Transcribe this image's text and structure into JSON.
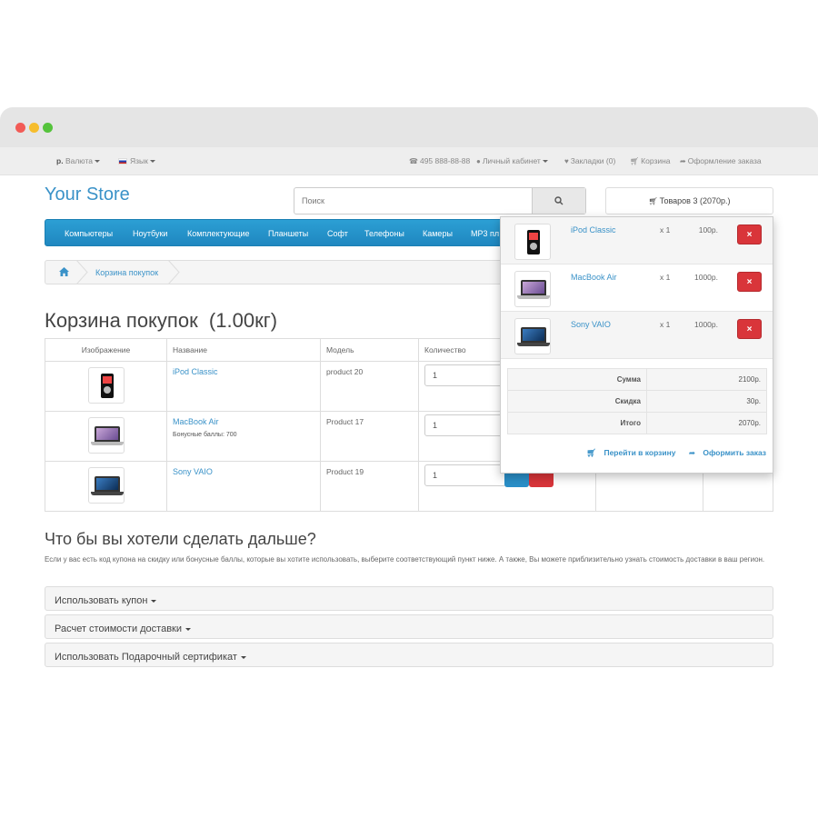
{
  "topbar": {
    "currency": "р.",
    "currency_label": "Валюта",
    "language_label": "Язык",
    "phone": "495 888-88-88",
    "account": "Личный кабинет",
    "wishlist": "Закладки (0)",
    "cart": "Корзина",
    "checkout": "Оформление заказа"
  },
  "header": {
    "logo": "Your Store",
    "search_placeholder": "Поиск",
    "cart_button": "Товаров 3 (2070р.)"
  },
  "nav": [
    "Компьютеры",
    "Ноутбуки",
    "Комплектующие",
    "Планшеты",
    "Софт",
    "Телефоны",
    "Камеры",
    "MP3 пл"
  ],
  "breadcrumb": {
    "current": "Корзина покупок"
  },
  "page_title": "Корзина покупок  (1.00кг)",
  "table": {
    "headers": [
      "Изображение",
      "Название",
      "Модель",
      "Количество"
    ],
    "rows": [
      {
        "name": "iPod Classic",
        "model": "product 20",
        "qty": "1",
        "note": ""
      },
      {
        "name": "MacBook Air",
        "model": "Product 17",
        "qty": "1",
        "note": "Бонусные баллы: 700"
      },
      {
        "name": "Sony VAIO",
        "model": "Product 19",
        "qty": "1",
        "note": ""
      }
    ]
  },
  "next": {
    "title": "Что бы вы хотели сделать дальше?",
    "description": "Если у вас есть код купона на скидку или бонусные баллы, которые вы хотите использовать, выберите соответствующий пункт ниже. А также, Вы можете приблизительно узнать стоимость доставки в ваш регион.",
    "panels": [
      "Использовать купон",
      "Расчет стоимости доставки",
      "Использовать Подарочный сертификат"
    ]
  },
  "dropdown": {
    "items": [
      {
        "name": "iPod Classic",
        "qty": "x 1",
        "price": "100р."
      },
      {
        "name": "MacBook Air",
        "qty": "x 1",
        "price": "1000р."
      },
      {
        "name": "Sony VAIO",
        "qty": "x 1",
        "price": "1000р."
      }
    ],
    "totals": [
      {
        "label": "Сумма",
        "value": "2100р."
      },
      {
        "label": "Скидка",
        "value": "30р."
      },
      {
        "label": "Итого",
        "value": "2070р."
      }
    ],
    "view_cart": "Перейти в корзину",
    "checkout": "Оформить заказ",
    "remove_icon": "×"
  },
  "colors": {
    "accent": "#3a92c8",
    "nav": "#1f87c0",
    "danger": "#d9353a"
  }
}
